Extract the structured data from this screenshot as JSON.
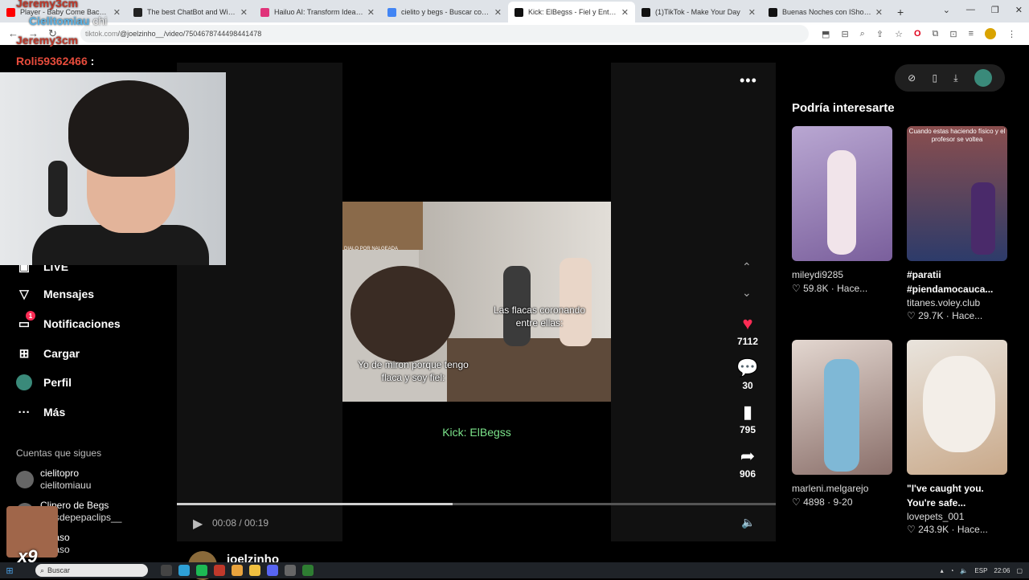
{
  "browser": {
    "tabs": [
      {
        "title": "Player - Baby Come Back - You",
        "color": "#ff0000",
        "active": false
      },
      {
        "title": "The best ChatBot and Widgets",
        "color": "#222222",
        "active": false
      },
      {
        "title": "Hailuo AI: Transform Idea to Vi",
        "color": "#e0337a",
        "active": false
      },
      {
        "title": "cielito y begs - Buscar con Goo",
        "color": "#4285f4",
        "active": false
      },
      {
        "title": "Kick: ElBegss - Fiel y Entretenid",
        "color": "#111111",
        "active": true
      },
      {
        "title": "(1)TikTok - Make Your Day",
        "color": "#111111",
        "active": false
      },
      {
        "title": "Buenas Noches con IShowSpee",
        "color": "#111111",
        "active": false
      }
    ],
    "url_prefix": "tiktok.com",
    "url_rest": "/@joelzinho__/video/7504678744498441478"
  },
  "sidebar": {
    "items": [
      {
        "label": "Mensajes",
        "icon": "paper-plane-icon",
        "glyph": "▽"
      },
      {
        "label": "Notificaciones",
        "icon": "inbox-icon",
        "glyph": "▭",
        "badge": "1"
      },
      {
        "label": "Cargar",
        "icon": "plus-square-icon",
        "glyph": "⊞"
      },
      {
        "label": "Perfil",
        "icon": "avatar-icon",
        "glyph": "●"
      },
      {
        "label": "Más",
        "icon": "more-dots-icon",
        "glyph": "···"
      }
    ],
    "partial_item": "LIVE",
    "following_title": "Cuentas que sigues",
    "following": [
      {
        "name": "cielitopro",
        "handle": "cielitomiauu"
      },
      {
        "name": "Clipero de Begs",
        "handle": "clipsdepepaclips__"
      },
      {
        "name": "robaso",
        "handle": "robaso"
      }
    ]
  },
  "video": {
    "top_note": "DIALO POR NALGEADA",
    "caption_top": "Las flacas coronando\nentre ellas:",
    "caption_bottom": "Yo de miron porque tengo\nflaca y soy fiel:",
    "below_caption": "Kick: ElBegss",
    "likes": "7112",
    "comments": "30",
    "saves": "795",
    "shares": "906",
    "time_current": "00:08",
    "time_total": "00:19",
    "progress_fraction": 0.46,
    "author": "joelzinho"
  },
  "recommendations": {
    "title": "Podría interesarte",
    "cards": [
      {
        "name": "mileydi9285",
        "likes": "59.8K",
        "date": "Hace...",
        "overlay": ""
      },
      {
        "name": "#paratii #piendamocauca...",
        "handle": "titanes.voley.club",
        "likes": "29.7K",
        "date": "Hace...",
        "overlay": "Cuando estas haciendo físico y el profesor se voltea"
      },
      {
        "name": "marleni.melgarejo",
        "likes": "4898",
        "date": "9-20",
        "overlay": ""
      },
      {
        "name": "\"I've caught you. You're safe...",
        "handle": "lovepets_001",
        "likes": "243.9K",
        "date": "Hace...",
        "overlay": ""
      }
    ]
  },
  "stream": {
    "chat": [
      {
        "user": "Jeremy3cm",
        "msg": "",
        "color": "#c0392b"
      },
      {
        "user": "Cielitomiau",
        "msg": "chi",
        "color": "#5bb4e6"
      },
      {
        "user": "Jeremy3cm",
        "msg": "",
        "color": "#c0392b"
      },
      {
        "user": "Roli59362466",
        "msg": ":",
        "color": "#e74c3c"
      }
    ],
    "multiplier": "x9"
  },
  "taskbar": {
    "search_placeholder": "Buscar",
    "lang": "ESP",
    "clock": "22:06"
  }
}
